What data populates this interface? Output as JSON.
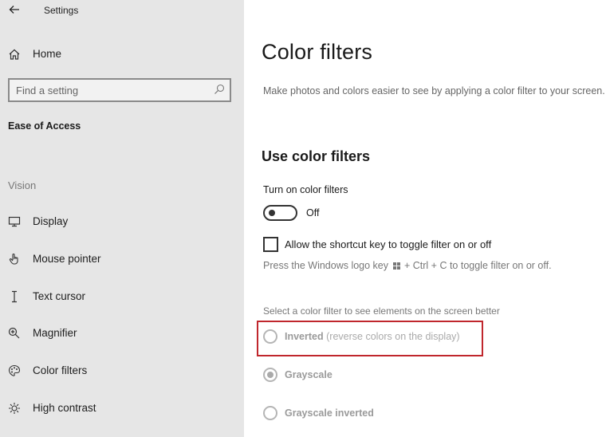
{
  "window": {
    "title": "Settings",
    "back_icon": "back-arrow-icon"
  },
  "sidebar": {
    "home": {
      "label": "Home",
      "icon": "home-icon"
    },
    "search": {
      "placeholder": "Find a setting",
      "value": "",
      "icon": "search-icon"
    },
    "section_title": "Ease of Access",
    "group_label": "Vision",
    "items": [
      {
        "label": "Display",
        "icon": "display-icon"
      },
      {
        "label": "Mouse pointer",
        "icon": "mouse-pointer-icon"
      },
      {
        "label": "Text cursor",
        "icon": "text-cursor-icon"
      },
      {
        "label": "Magnifier",
        "icon": "magnifier-icon"
      },
      {
        "label": "Color filters",
        "icon": "color-filters-icon"
      },
      {
        "label": "High contrast",
        "icon": "high-contrast-icon"
      }
    ]
  },
  "main": {
    "title": "Color filters",
    "description": "Make photos and colors easier to see by applying a color filter to your screen.",
    "subtitle": "Use color filters",
    "toggle": {
      "label": "Turn on color filters",
      "state": "Off",
      "on": false
    },
    "shortcut_checkbox": {
      "label": "Allow the shortcut key to toggle filter on or off",
      "checked": false
    },
    "hint": {
      "before": "Press the Windows logo key",
      "after": "+ Ctrl + C to toggle filter on or off."
    },
    "filter_label": "Select a color filter to see elements on the screen better",
    "filters": [
      {
        "name": "Inverted",
        "description": "(reverse colors on the display)",
        "selected": false,
        "highlighted": true
      },
      {
        "name": "Grayscale",
        "description": "",
        "selected": true,
        "highlighted": false
      },
      {
        "name": "Grayscale inverted",
        "description": "",
        "selected": false,
        "highlighted": false
      }
    ],
    "highlight_color": "#c0272d"
  }
}
